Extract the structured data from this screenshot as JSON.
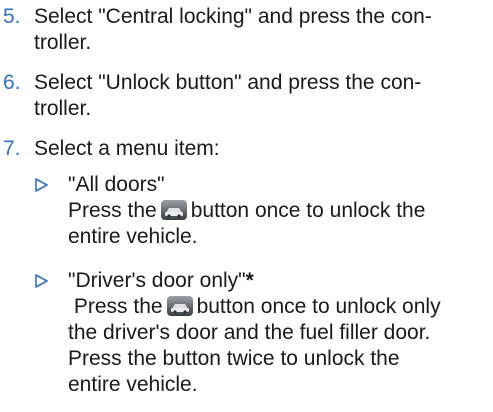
{
  "steps": [
    {
      "number": "5.",
      "lines": [
        "Select \"Central locking\" and press the con-",
        "troller."
      ]
    },
    {
      "number": "6.",
      "lines": [
        "Select \"Unlock button\" and press the con-",
        "troller."
      ]
    },
    {
      "number": "7.",
      "lines": [
        "Select a menu item:"
      ]
    }
  ],
  "subitems": [
    {
      "title": "\"All doors\"",
      "line1_before": "Press the",
      "line1_after": "button once to unlock the",
      "lines_rest": [
        "entire vehicle."
      ]
    },
    {
      "title": "\"Driver's door only\"",
      "title_star": "*",
      "line1_before": "Press the",
      "line1_after": "button once to unlock only",
      "lines_rest": [
        "the driver's door and the fuel filler door.",
        "Press the button twice to unlock the",
        "entire vehicle."
      ]
    }
  ],
  "icon_names": [
    "unlock-car-button-icon"
  ],
  "colors": {
    "step_number": "#2f74c6",
    "bullet_triangle": "#2f74c6",
    "text": "#1a1a1a"
  }
}
